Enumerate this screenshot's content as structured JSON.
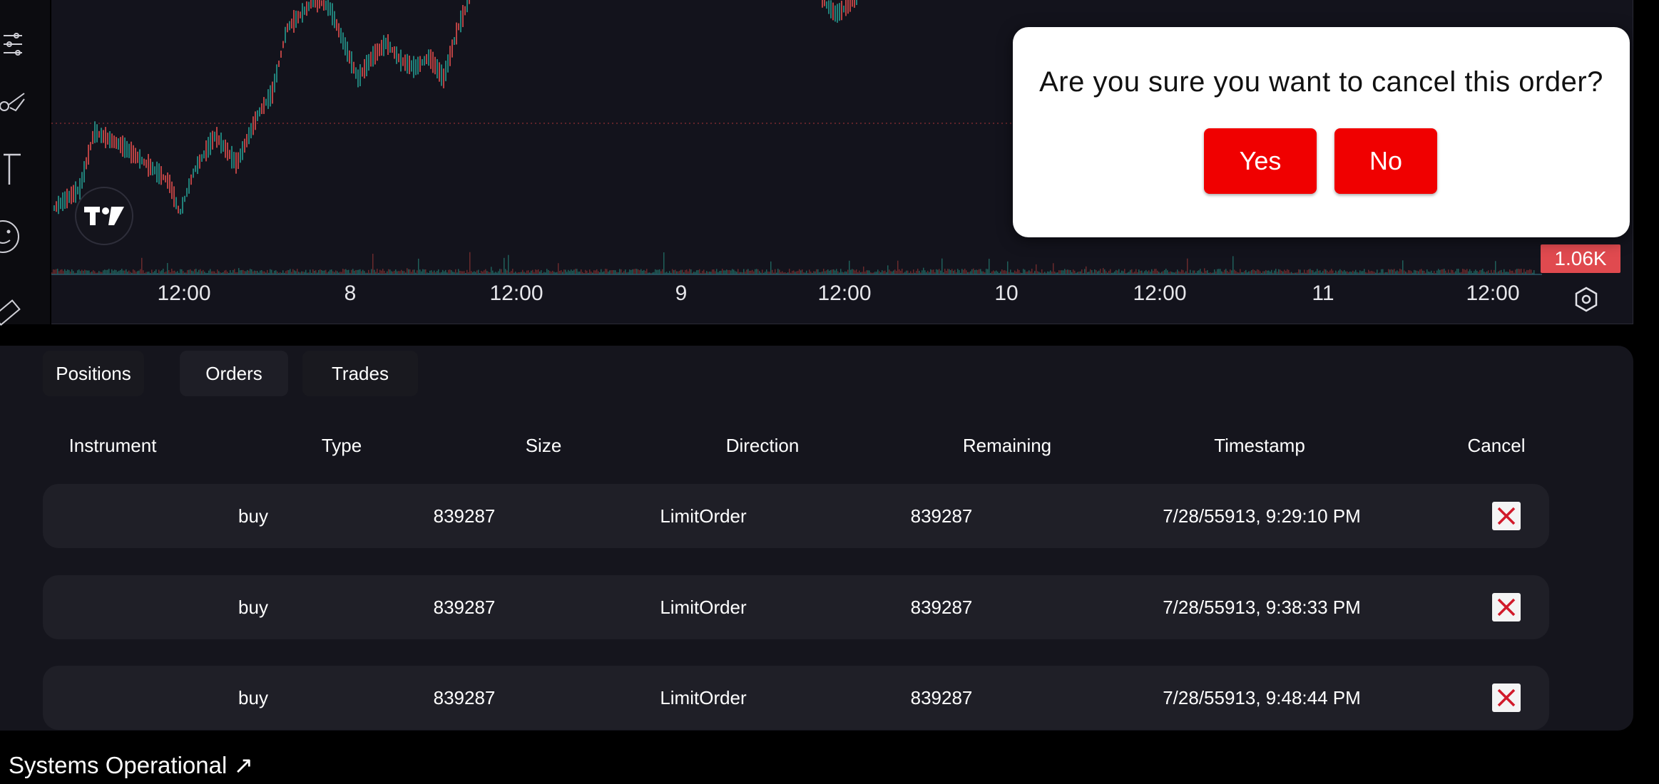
{
  "chart": {
    "x_axis_labels": [
      "12:00",
      "8",
      "12:00",
      "9",
      "12:00",
      "10",
      "12:00",
      "11",
      "12:00"
    ],
    "volume_label": "1.06K",
    "accent_up": "#26a69a",
    "accent_down": "#ef5350",
    "volume_badge_color": "#e04a4f"
  },
  "toolbar": {
    "icons": [
      "settings-sliders-icon",
      "brush-icon",
      "text-icon",
      "emoji-icon",
      "ruler-icon"
    ]
  },
  "dialog": {
    "message": "Are you sure you want to cancel this order?",
    "yes_label": "Yes",
    "no_label": "No",
    "button_color": "#f00000"
  },
  "tabs": [
    {
      "label": "Positions"
    },
    {
      "label": "Orders"
    },
    {
      "label": "Trades"
    }
  ],
  "orders_table": {
    "columns": [
      "Instrument",
      "Type",
      "Size",
      "Direction",
      "Remaining",
      "Timestamp",
      "Cancel"
    ],
    "rows": [
      {
        "instrument": "",
        "type": "buy",
        "size": "839287",
        "direction": "LimitOrder",
        "remaining": "839287",
        "timestamp": "7/28/55913, 9:29:10 PM"
      },
      {
        "instrument": "",
        "type": "buy",
        "size": "839287",
        "direction": "LimitOrder",
        "remaining": "839287",
        "timestamp": "7/28/55913, 9:38:33 PM"
      },
      {
        "instrument": "",
        "type": "buy",
        "size": "839287",
        "direction": "LimitOrder",
        "remaining": "839287",
        "timestamp": "7/28/55913, 9:48:44 PM"
      }
    ]
  },
  "footer": {
    "status_text": "Systems Operational ↗"
  }
}
